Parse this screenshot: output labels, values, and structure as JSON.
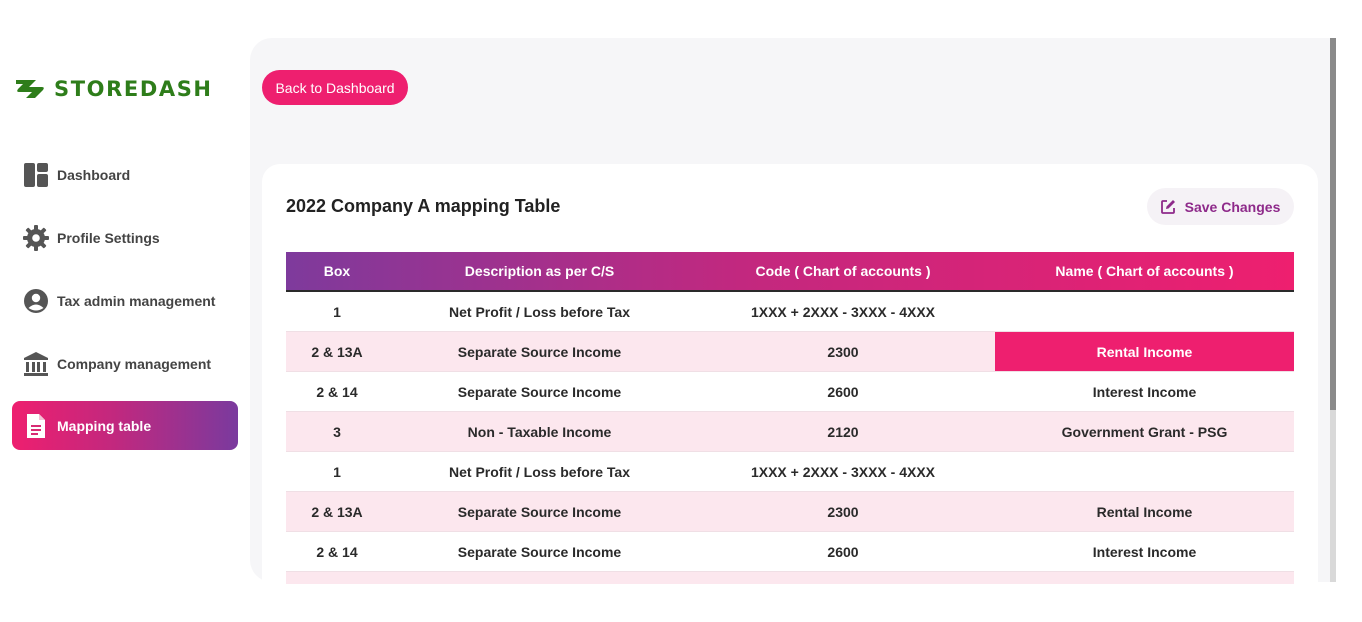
{
  "brand": {
    "name": "STOREDASH",
    "color": "#2e7d1a"
  },
  "sidebar": {
    "items": [
      {
        "label": "Dashboard",
        "icon": "dashboard-icon",
        "active": false
      },
      {
        "label": "Profile Settings",
        "icon": "gear-icon",
        "active": false
      },
      {
        "label": "Tax admin management",
        "icon": "user-circle-icon",
        "active": false
      },
      {
        "label": "Company management",
        "icon": "bank-icon",
        "active": false
      },
      {
        "label": "Mapping table",
        "icon": "document-icon",
        "active": true
      }
    ]
  },
  "header": {
    "back_label": "Back to Dashboard"
  },
  "card": {
    "title": "2022 Company A mapping Table",
    "save_label": "Save Changes",
    "save_icon": "edit-icon"
  },
  "table": {
    "columns": [
      "Box",
      "Description as per C/S",
      "Code ( Chart of accounts )",
      "Name ( Chart of accounts )"
    ],
    "rows": [
      {
        "box": "1",
        "description": "Net Profit / Loss before Tax",
        "code": "1XXX + 2XXX - 3XXX - 4XXX",
        "name": ""
      },
      {
        "box": "2 & 13A",
        "description": "Separate Source Income",
        "code": "2300",
        "name": "Rental Income",
        "highlighted": true
      },
      {
        "box": "2 & 14",
        "description": "Separate Source Income",
        "code": "2600",
        "name": "Interest Income"
      },
      {
        "box": "3",
        "description": "Non - Taxable Income",
        "code": "2120",
        "name": "Government Grant - PSG"
      },
      {
        "box": "1",
        "description": "Net Profit / Loss before Tax",
        "code": "1XXX + 2XXX - 3XXX - 4XXX",
        "name": ""
      },
      {
        "box": "2 & 13A",
        "description": "Separate Source Income",
        "code": "2300",
        "name": "Rental Income"
      },
      {
        "box": "2 & 14",
        "description": "Separate Source Income",
        "code": "2600",
        "name": "Interest Income"
      },
      {
        "box": "",
        "description": "",
        "code": "",
        "name": ""
      }
    ]
  },
  "colors": {
    "accent": "#ee1f6f",
    "purple": "#7e3a9c",
    "row_tint": "#fce7ee",
    "save_text": "#8e2a8a"
  }
}
